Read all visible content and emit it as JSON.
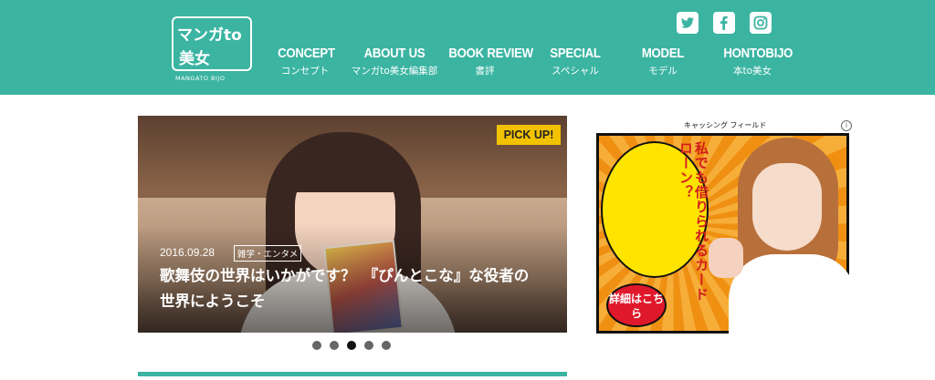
{
  "header": {
    "logo": {
      "line1": "マンガto",
      "line2": "美女",
      "sub": "MANGATO BIJO"
    },
    "nav": [
      {
        "en": "CONCEPT",
        "jp": "コンセプト"
      },
      {
        "en": "ABOUT US",
        "jp": "マンガto美女編集部"
      },
      {
        "en": "BOOK REVIEW",
        "jp": "書評"
      },
      {
        "en": "SPECIAL",
        "jp": "スペシャル"
      },
      {
        "en": "MODEL",
        "jp": "モデル"
      },
      {
        "en": "HONTOBIJO",
        "jp": "本to美女"
      }
    ],
    "social": [
      "twitter-icon",
      "facebook-icon",
      "instagram-icon"
    ]
  },
  "slider": {
    "badge": "PICK UP!",
    "date": "2016.09.28",
    "category": "雑学・エンタメ",
    "title": "歌舞伎の世界はいかがです？　『ぴんとこな』な役者の世界にようこそ",
    "dots_total": 5,
    "dots_active_index": 2
  },
  "ad": {
    "brand": "キャッシング フィールド",
    "headline": "私でも借りられるカードローン？",
    "cta": "詳細はこちら",
    "info_glyph": "i"
  },
  "colors": {
    "brand": "#3bb4a2",
    "badge": "#f2c200",
    "ad_red": "#e0182b",
    "ad_yellow": "#ffe400"
  }
}
